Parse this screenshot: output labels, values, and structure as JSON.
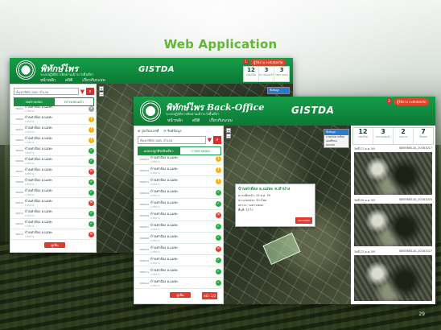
{
  "slide": {
    "title": "Web Application",
    "page_number": "29"
  },
  "brand": {
    "name": "พิทักษ์ไพร",
    "backoffice_name": "พิทักษ์ไพร Back-Office",
    "subtitle": "ระบบปฏิบัติการติดตามเฝ้าระวังพื้นที่ป่า",
    "gistda": "GISTDA"
  },
  "front": {
    "nav": [
      "หน้าหลัก",
      "สถิติ",
      "เกี่ยวกับระบบ"
    ],
    "user": "ผู้ใช้งาน ระดับจังหวัด",
    "stats": [
      {
        "num": "12",
        "label": "แปลงใหม่"
      },
      {
        "num": "3",
        "label": "ตรวจสอบแล้ว"
      },
      {
        "num": "3",
        "label": "รอตรวจสอบ"
      }
    ],
    "search_placeholder": "ค้นหาพิกัด อบต. อำเภอ",
    "tabs": [
      "รอตรวจสอบ",
      "ตรวจสอบแล้ว"
    ],
    "rows": [
      {
        "id": "00001",
        "title": "บ้านท่าต้อง อ.แม่ทะ",
        "sub": "จ.ลำปาง",
        "status": "grey"
      },
      {
        "id": "00002",
        "title": "บ้านท่าต้อง อ.แม่ทะ",
        "sub": "จ.ลำปาง",
        "status": "wait"
      },
      {
        "id": "00003",
        "title": "บ้านท่าต้อง อ.แม่ทะ",
        "sub": "จ.ลำปาง",
        "status": "wait"
      },
      {
        "id": "00004",
        "title": "บ้านท่าต้อง อ.แม่ทะ",
        "sub": "จ.ลำปาง",
        "status": "wait"
      },
      {
        "id": "00005",
        "title": "บ้านท่าต้อง อ.แม่ทะ",
        "sub": "จ.ลำปาง",
        "status": "ok"
      },
      {
        "id": "00006",
        "title": "บ้านท่าต้อง อ.แม่ทะ",
        "sub": "จ.ลำปาง",
        "status": "ok"
      },
      {
        "id": "00007",
        "title": "บ้านท่าต้อง อ.แม่ทะ",
        "sub": "จ.ลำปาง",
        "status": "no"
      },
      {
        "id": "00008",
        "title": "บ้านท่าต้อง อ.แม่ทะ",
        "sub": "จ.ลำปาง",
        "status": "ok"
      },
      {
        "id": "00009",
        "title": "บ้านท่าต้อง อ.แม่ทะ",
        "sub": "จ.ลำปาง",
        "status": "ok"
      },
      {
        "id": "00010",
        "title": "บ้านท่าต้อง อ.แม่ทะ",
        "sub": "จ.ลำปาง",
        "status": "no"
      },
      {
        "id": "00011",
        "title": "บ้านท่าต้อง อ.แม่ทะ",
        "sub": "จ.ลำปาง",
        "status": "ok"
      },
      {
        "id": "00012",
        "title": "บ้านท่าต้อง อ.แม่ทะ",
        "sub": "จ.ลำปาง",
        "status": "ok"
      },
      {
        "id": "00013",
        "title": "บ้านท่าต้อง อ.แม่ทะ",
        "sub": "จ.ลำปาง",
        "status": "no"
      }
    ],
    "page_button": "ดูเพิ่ม"
  },
  "back": {
    "nav": [
      "หน้าหลัก",
      "สถิติ",
      "เกี่ยวกับระบบ"
    ],
    "user": "ผู้ใช้งาน ระดับจังหวัด",
    "stats": [
      {
        "num": "12",
        "label": "แปลงใหม่"
      },
      {
        "num": "3",
        "label": "ตรวจสอบแล้ว"
      },
      {
        "num": "2",
        "label": "รอตรวจ"
      },
      {
        "num": "7",
        "label": "ทั้งหมด"
      }
    ],
    "toolbar": [
      "รูปเรียงเลขที่",
      "ซิงค์ข้อมูล"
    ],
    "search_placeholder": "ค้นหาพิกัด อบต. อำเภอ",
    "tabs": [
      "แปลงปลูกพืชเชิงเดี่ยว",
      "การตรวจสอบ"
    ],
    "rows": [
      {
        "id": "000001",
        "title": "บ้านท่าต้อง อ.แม่ทะ",
        "sub": "จ.ลำปาง",
        "status": "wait"
      },
      {
        "id": "000002",
        "title": "บ้านท่าต้อง อ.แม่ทะ",
        "sub": "จ.ลำปาง",
        "status": "wait"
      },
      {
        "id": "000003",
        "title": "บ้านท่าต้อง อ.แม่ทะ",
        "sub": "จ.ลำปาง",
        "status": "wait"
      },
      {
        "id": "000004",
        "title": "บ้านท่าต้อง อ.แม่ทะ",
        "sub": "จ.ลำปาง",
        "status": "ok"
      },
      {
        "id": "000005",
        "title": "บ้านท่าต้อง อ.แม่ทะ",
        "sub": "จ.ลำปาง",
        "status": "ok"
      },
      {
        "id": "000006",
        "title": "บ้านท่าต้อง อ.แม่ทะ",
        "sub": "จ.ลำปาง",
        "status": "no"
      },
      {
        "id": "000007",
        "title": "บ้านท่าต้อง อ.แม่ทะ",
        "sub": "จ.ลำปาง",
        "status": "ok"
      },
      {
        "id": "000008",
        "title": "บ้านท่าต้อง อ.แม่ทะ",
        "sub": "จ.ลำปาง",
        "status": "ok"
      },
      {
        "id": "000009",
        "title": "บ้านท่าต้อง อ.แม่ทะ",
        "sub": "จ.ลำปาง",
        "status": "no"
      },
      {
        "id": "000010",
        "title": "บ้านท่าต้อง อ.แม่ทะ",
        "sub": "จ.ลำปาง",
        "status": "ok"
      },
      {
        "id": "000011",
        "title": "บ้านท่าต้อง อ.แม่ทะ",
        "sub": "จ.ลำปาง",
        "status": "ok"
      },
      {
        "id": "000012",
        "title": "บ้านท่าต้อง อ.แม่ทะ",
        "sub": "จ.ลำปาง",
        "status": "ok"
      }
    ],
    "page_button": "ดูเพิ่ม",
    "page_indicator": "หน้า 1/2",
    "popup": {
      "title": "บ้านท่าต้อง อ.แม่ทะ จ.ลำปาง",
      "lines": [
        "ความคืบหน้า: 25 ต.ค. 59",
        "ประเภทแปลง: ข้าวโพด",
        "สถานะ: รอตรวจสอบ",
        "พื้นที่: 32 ไร่"
      ],
      "button": "ตรวจสอบ"
    },
    "layer_box": {
      "header": "ชั้นข้อมูล",
      "items": [
        "ภาพถ่ายดาวเทียม",
        "แผนที่ถนน",
        "ขอบเขต"
      ]
    },
    "imagery": [
      {
        "date": "วันที่ 17 ต.ค. 59",
        "name": "SENTINEL2A_20161017"
      },
      {
        "date": "วันที่ 25 ต.ค. 59",
        "name": "SENTINEL2A_20161025"
      },
      {
        "date": "วันที่ 27 ต.ค. 59",
        "name": "SENTINEL2A_20161027"
      }
    ]
  },
  "colors": {
    "brand_green": "#169d48",
    "accent_red": "#e03a2a",
    "ok": "#27a844",
    "wait": "#f1b11c",
    "title_green": "#5fb82f"
  }
}
